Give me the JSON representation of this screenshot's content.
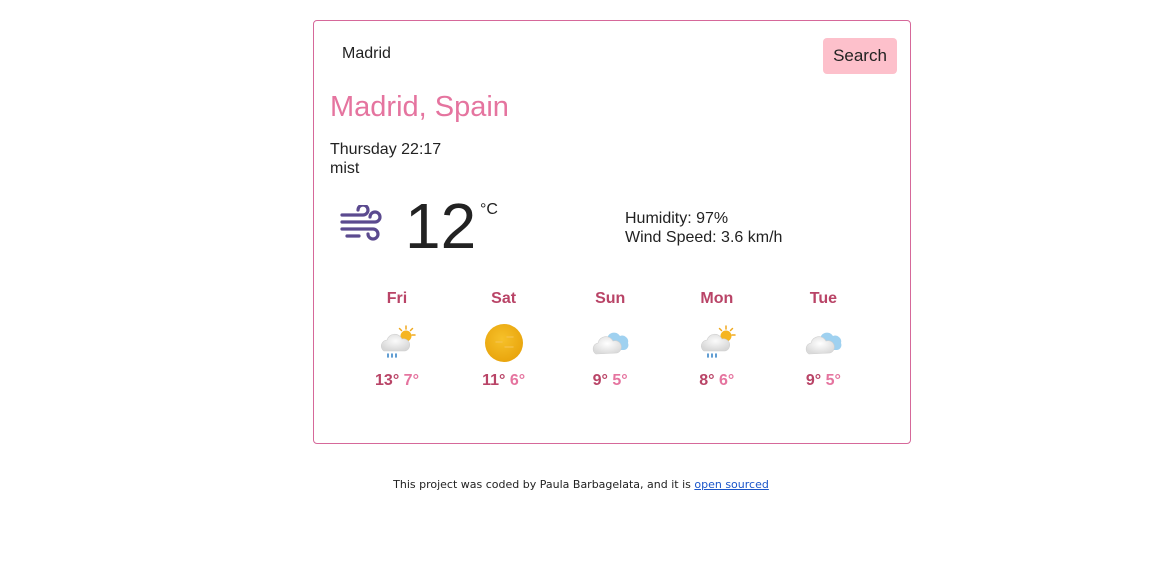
{
  "search": {
    "value": "Madrid",
    "button_label": "Search"
  },
  "current": {
    "city": "Madrid, Spain",
    "date": "Thursday 22:17",
    "description": "mist",
    "icon": "wind-icon",
    "temperature": "12",
    "unit": "°C",
    "humidity_label": "Humidity: 97%",
    "wind_label": "Wind Speed: 3.6 km/h"
  },
  "forecast": [
    {
      "day": "Fri",
      "icon": "rain-sun-icon",
      "max": "13°",
      "min": "7°"
    },
    {
      "day": "Sat",
      "icon": "sun-icon",
      "max": "11°",
      "min": "6°"
    },
    {
      "day": "Sun",
      "icon": "cloud-icon",
      "max": "9°",
      "min": "5°"
    },
    {
      "day": "Mon",
      "icon": "rain-sun-icon",
      "max": "8°",
      "min": "6°"
    },
    {
      "day": "Tue",
      "icon": "cloud-icon",
      "max": "9°",
      "min": "5°"
    }
  ],
  "footer": {
    "text": "This project was coded by Paula Barbagelata, and it is",
    "link_text": "open sourced"
  },
  "colors": {
    "accent": "#e5749f",
    "accent_dark": "#b94467",
    "button_bg": "#fdc0cb",
    "border": "#d6689a",
    "link": "#1a55c9"
  }
}
